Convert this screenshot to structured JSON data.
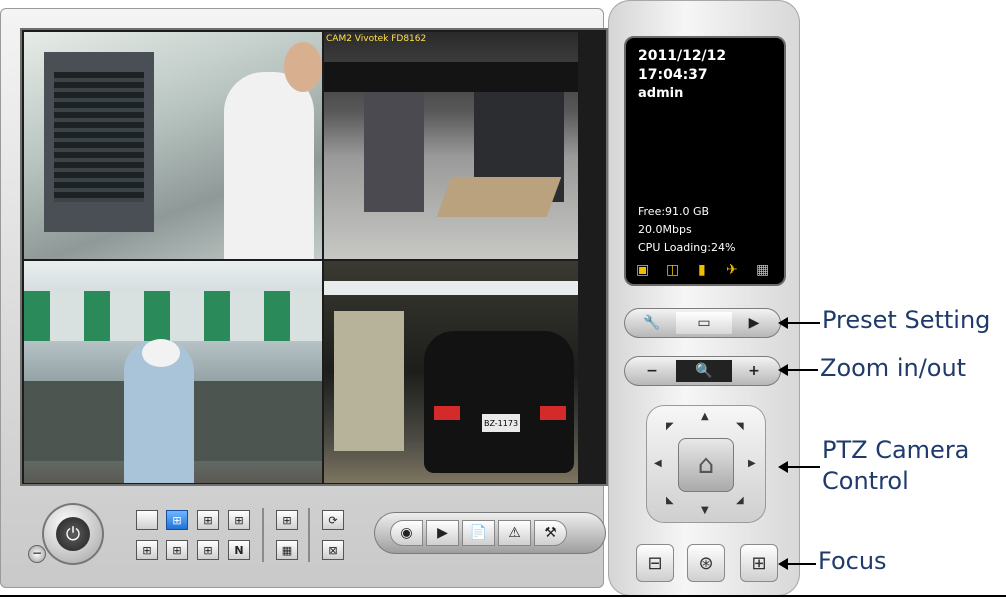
{
  "camera_views": [
    {
      "label": ""
    },
    {
      "label": "CAM2 Vivotek FD8162"
    },
    {
      "label": ""
    },
    {
      "label": ""
    }
  ],
  "status": {
    "date": "2011/12/12",
    "time": "17:04:37",
    "user": "admin",
    "free_space": "Free:91.0 GB",
    "bitrate": "20.0Mbps",
    "cpu_loading": "CPU Loading:24%"
  },
  "car_plate": "BZ-1173",
  "callouts": {
    "preset_setting": "Preset Setting",
    "zoom": "Zoom in/out",
    "ptz_line1": "PTZ Camera",
    "ptz_line2": "Control",
    "focus": "Focus"
  },
  "icon_colors": {
    "status_icons": "#f0c000"
  },
  "layout_buttons": [
    "single-view",
    "quad-view",
    "six-view",
    "nine-view",
    "thirteen-view",
    "sixteen-view",
    "twenty-view",
    "next-page",
    "grid-a",
    "grid-b",
    "sequence",
    "full-screen"
  ],
  "toolbar_icons": [
    "record",
    "playback",
    "schedule",
    "alarm",
    "config"
  ]
}
